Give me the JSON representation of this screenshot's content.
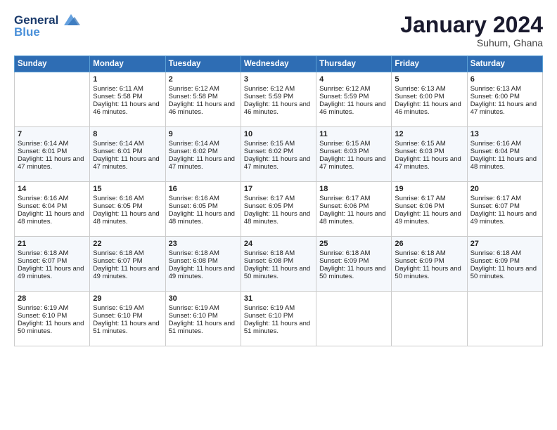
{
  "logo": {
    "line1": "General",
    "line2": "Blue"
  },
  "title": "January 2024",
  "subtitle": "Suhum, Ghana",
  "header_days": [
    "Sunday",
    "Monday",
    "Tuesday",
    "Wednesday",
    "Thursday",
    "Friday",
    "Saturday"
  ],
  "weeks": [
    [
      {
        "day": "",
        "sunrise": "",
        "sunset": "",
        "daylight": ""
      },
      {
        "day": "1",
        "sunrise": "Sunrise: 6:11 AM",
        "sunset": "Sunset: 5:58 PM",
        "daylight": "Daylight: 11 hours and 46 minutes."
      },
      {
        "day": "2",
        "sunrise": "Sunrise: 6:12 AM",
        "sunset": "Sunset: 5:58 PM",
        "daylight": "Daylight: 11 hours and 46 minutes."
      },
      {
        "day": "3",
        "sunrise": "Sunrise: 6:12 AM",
        "sunset": "Sunset: 5:59 PM",
        "daylight": "Daylight: 11 hours and 46 minutes."
      },
      {
        "day": "4",
        "sunrise": "Sunrise: 6:12 AM",
        "sunset": "Sunset: 5:59 PM",
        "daylight": "Daylight: 11 hours and 46 minutes."
      },
      {
        "day": "5",
        "sunrise": "Sunrise: 6:13 AM",
        "sunset": "Sunset: 6:00 PM",
        "daylight": "Daylight: 11 hours and 46 minutes."
      },
      {
        "day": "6",
        "sunrise": "Sunrise: 6:13 AM",
        "sunset": "Sunset: 6:00 PM",
        "daylight": "Daylight: 11 hours and 47 minutes."
      }
    ],
    [
      {
        "day": "7",
        "sunrise": "Sunrise: 6:14 AM",
        "sunset": "Sunset: 6:01 PM",
        "daylight": "Daylight: 11 hours and 47 minutes."
      },
      {
        "day": "8",
        "sunrise": "Sunrise: 6:14 AM",
        "sunset": "Sunset: 6:01 PM",
        "daylight": "Daylight: 11 hours and 47 minutes."
      },
      {
        "day": "9",
        "sunrise": "Sunrise: 6:14 AM",
        "sunset": "Sunset: 6:02 PM",
        "daylight": "Daylight: 11 hours and 47 minutes."
      },
      {
        "day": "10",
        "sunrise": "Sunrise: 6:15 AM",
        "sunset": "Sunset: 6:02 PM",
        "daylight": "Daylight: 11 hours and 47 minutes."
      },
      {
        "day": "11",
        "sunrise": "Sunrise: 6:15 AM",
        "sunset": "Sunset: 6:03 PM",
        "daylight": "Daylight: 11 hours and 47 minutes."
      },
      {
        "day": "12",
        "sunrise": "Sunrise: 6:15 AM",
        "sunset": "Sunset: 6:03 PM",
        "daylight": "Daylight: 11 hours and 47 minutes."
      },
      {
        "day": "13",
        "sunrise": "Sunrise: 6:16 AM",
        "sunset": "Sunset: 6:04 PM",
        "daylight": "Daylight: 11 hours and 48 minutes."
      }
    ],
    [
      {
        "day": "14",
        "sunrise": "Sunrise: 6:16 AM",
        "sunset": "Sunset: 6:04 PM",
        "daylight": "Daylight: 11 hours and 48 minutes."
      },
      {
        "day": "15",
        "sunrise": "Sunrise: 6:16 AM",
        "sunset": "Sunset: 6:05 PM",
        "daylight": "Daylight: 11 hours and 48 minutes."
      },
      {
        "day": "16",
        "sunrise": "Sunrise: 6:16 AM",
        "sunset": "Sunset: 6:05 PM",
        "daylight": "Daylight: 11 hours and 48 minutes."
      },
      {
        "day": "17",
        "sunrise": "Sunrise: 6:17 AM",
        "sunset": "Sunset: 6:05 PM",
        "daylight": "Daylight: 11 hours and 48 minutes."
      },
      {
        "day": "18",
        "sunrise": "Sunrise: 6:17 AM",
        "sunset": "Sunset: 6:06 PM",
        "daylight": "Daylight: 11 hours and 48 minutes."
      },
      {
        "day": "19",
        "sunrise": "Sunrise: 6:17 AM",
        "sunset": "Sunset: 6:06 PM",
        "daylight": "Daylight: 11 hours and 49 minutes."
      },
      {
        "day": "20",
        "sunrise": "Sunrise: 6:17 AM",
        "sunset": "Sunset: 6:07 PM",
        "daylight": "Daylight: 11 hours and 49 minutes."
      }
    ],
    [
      {
        "day": "21",
        "sunrise": "Sunrise: 6:18 AM",
        "sunset": "Sunset: 6:07 PM",
        "daylight": "Daylight: 11 hours and 49 minutes."
      },
      {
        "day": "22",
        "sunrise": "Sunrise: 6:18 AM",
        "sunset": "Sunset: 6:07 PM",
        "daylight": "Daylight: 11 hours and 49 minutes."
      },
      {
        "day": "23",
        "sunrise": "Sunrise: 6:18 AM",
        "sunset": "Sunset: 6:08 PM",
        "daylight": "Daylight: 11 hours and 49 minutes."
      },
      {
        "day": "24",
        "sunrise": "Sunrise: 6:18 AM",
        "sunset": "Sunset: 6:08 PM",
        "daylight": "Daylight: 11 hours and 50 minutes."
      },
      {
        "day": "25",
        "sunrise": "Sunrise: 6:18 AM",
        "sunset": "Sunset: 6:09 PM",
        "daylight": "Daylight: 11 hours and 50 minutes."
      },
      {
        "day": "26",
        "sunrise": "Sunrise: 6:18 AM",
        "sunset": "Sunset: 6:09 PM",
        "daylight": "Daylight: 11 hours and 50 minutes."
      },
      {
        "day": "27",
        "sunrise": "Sunrise: 6:18 AM",
        "sunset": "Sunset: 6:09 PM",
        "daylight": "Daylight: 11 hours and 50 minutes."
      }
    ],
    [
      {
        "day": "28",
        "sunrise": "Sunrise: 6:19 AM",
        "sunset": "Sunset: 6:10 PM",
        "daylight": "Daylight: 11 hours and 50 minutes."
      },
      {
        "day": "29",
        "sunrise": "Sunrise: 6:19 AM",
        "sunset": "Sunset: 6:10 PM",
        "daylight": "Daylight: 11 hours and 51 minutes."
      },
      {
        "day": "30",
        "sunrise": "Sunrise: 6:19 AM",
        "sunset": "Sunset: 6:10 PM",
        "daylight": "Daylight: 11 hours and 51 minutes."
      },
      {
        "day": "31",
        "sunrise": "Sunrise: 6:19 AM",
        "sunset": "Sunset: 6:10 PM",
        "daylight": "Daylight: 11 hours and 51 minutes."
      },
      {
        "day": "",
        "sunrise": "",
        "sunset": "",
        "daylight": ""
      },
      {
        "day": "",
        "sunrise": "",
        "sunset": "",
        "daylight": ""
      },
      {
        "day": "",
        "sunrise": "",
        "sunset": "",
        "daylight": ""
      }
    ]
  ]
}
